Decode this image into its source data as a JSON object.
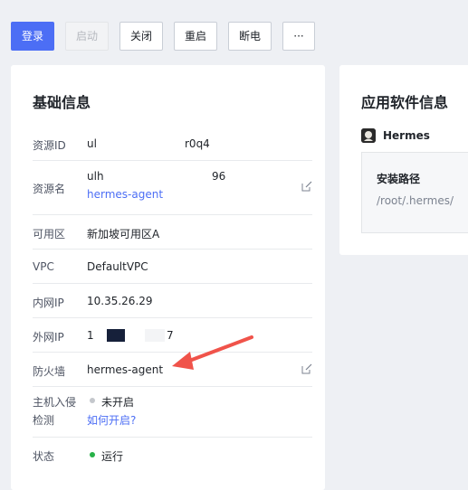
{
  "toolbar": {
    "login": "登录",
    "start": "启动",
    "close": "关闭",
    "restart": "重启",
    "power_off": "断电",
    "more": "···"
  },
  "basic_info": {
    "title": "基础信息",
    "rows": [
      {
        "label": "资源ID",
        "value": "ul",
        "value_tail": "r0q4"
      },
      {
        "label": "资源名",
        "value": "ulh",
        "value_tail": "96",
        "sub": "hermes-agent"
      },
      {
        "label": "可用区",
        "value": "新加坡可用区A"
      },
      {
        "label": "VPC",
        "value": "DefaultVPC"
      },
      {
        "label": "内网IP",
        "value": "10.35.26.29"
      },
      {
        "label": "外网IP",
        "value": "1",
        "value_tail": "7"
      },
      {
        "label": "防火墙",
        "value": "hermes-agent"
      },
      {
        "label": "主机入侵",
        "label2": "检测",
        "value": "未开启",
        "sub": "如何开启?"
      },
      {
        "label": "状态",
        "value": "运行"
      }
    ]
  },
  "app_info": {
    "title": "应用软件信息",
    "app_name": "Hermes",
    "path_title": "安装路径",
    "path_value": "/root/.hermes/"
  },
  "colors": {
    "primary": "#4c6ef5",
    "status_running": "#27b148",
    "status_off": "#c4c7cc",
    "annotation_arrow": "#f0534a"
  },
  "icons": {
    "edit": "edit-icon",
    "app_logo": "hermes-logo-icon"
  }
}
